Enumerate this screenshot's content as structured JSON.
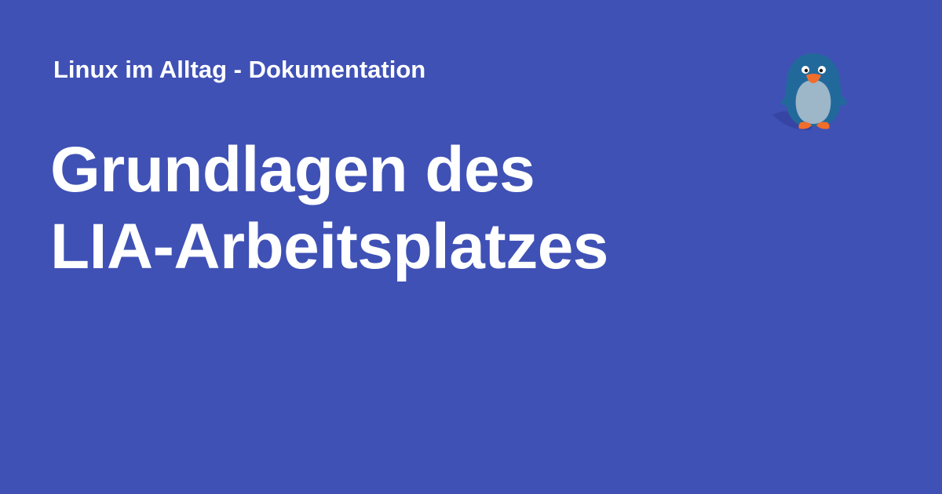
{
  "page": {
    "background_color": "#3f51b5",
    "text_color": "#ffffff"
  },
  "header": {
    "site_name": "Linux im Alltag - Dokumentation"
  },
  "title": {
    "line_1": "Grundlagen des",
    "line_2": "LIA-Arbeitsplatzes"
  },
  "logo": {
    "icon": "penguin-icon",
    "colors": {
      "body": "#22699b",
      "belly": "#9db6c8",
      "beak_and_feet": "#f06e2c",
      "shadow": "#2f3d94"
    }
  }
}
